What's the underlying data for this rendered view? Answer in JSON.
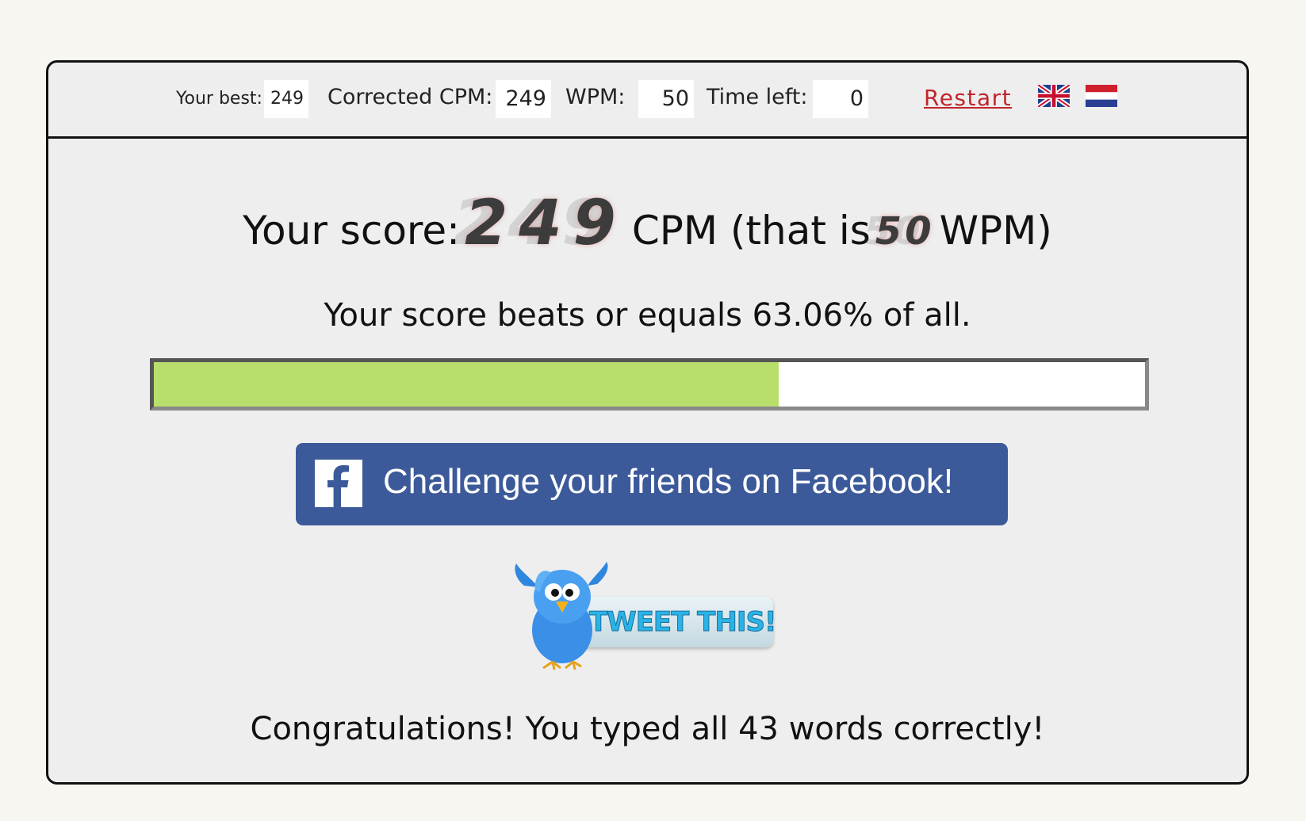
{
  "topbar": {
    "best_label": "Your best:",
    "best_value": "249",
    "cpm_label": "Corrected CPM:",
    "cpm_value": "249",
    "wpm_label": "WPM:",
    "wpm_value": "50",
    "time_label": "Time left:",
    "time_value": "0",
    "restart_label": "Restart",
    "flags": [
      "uk-flag-icon",
      "dutch-flag-icon"
    ]
  },
  "score": {
    "prefix": "Your score:",
    "cpm": "249",
    "middle": "CPM (that is",
    "wpm": "50",
    "suffix": "WPM)"
  },
  "percentile": {
    "text": "Your score beats or equals 63.06% of all.",
    "value": 0.6306,
    "fill_color": "#b8df6c"
  },
  "facebook": {
    "label": "Challenge your friends on Facebook!",
    "icon": "facebook-icon",
    "color": "#3c5a9a"
  },
  "tweet": {
    "label": "TWEET THIS!",
    "icon": "twitter-bird-icon"
  },
  "congrats": "Congratulations! You typed all 43 words correctly!"
}
